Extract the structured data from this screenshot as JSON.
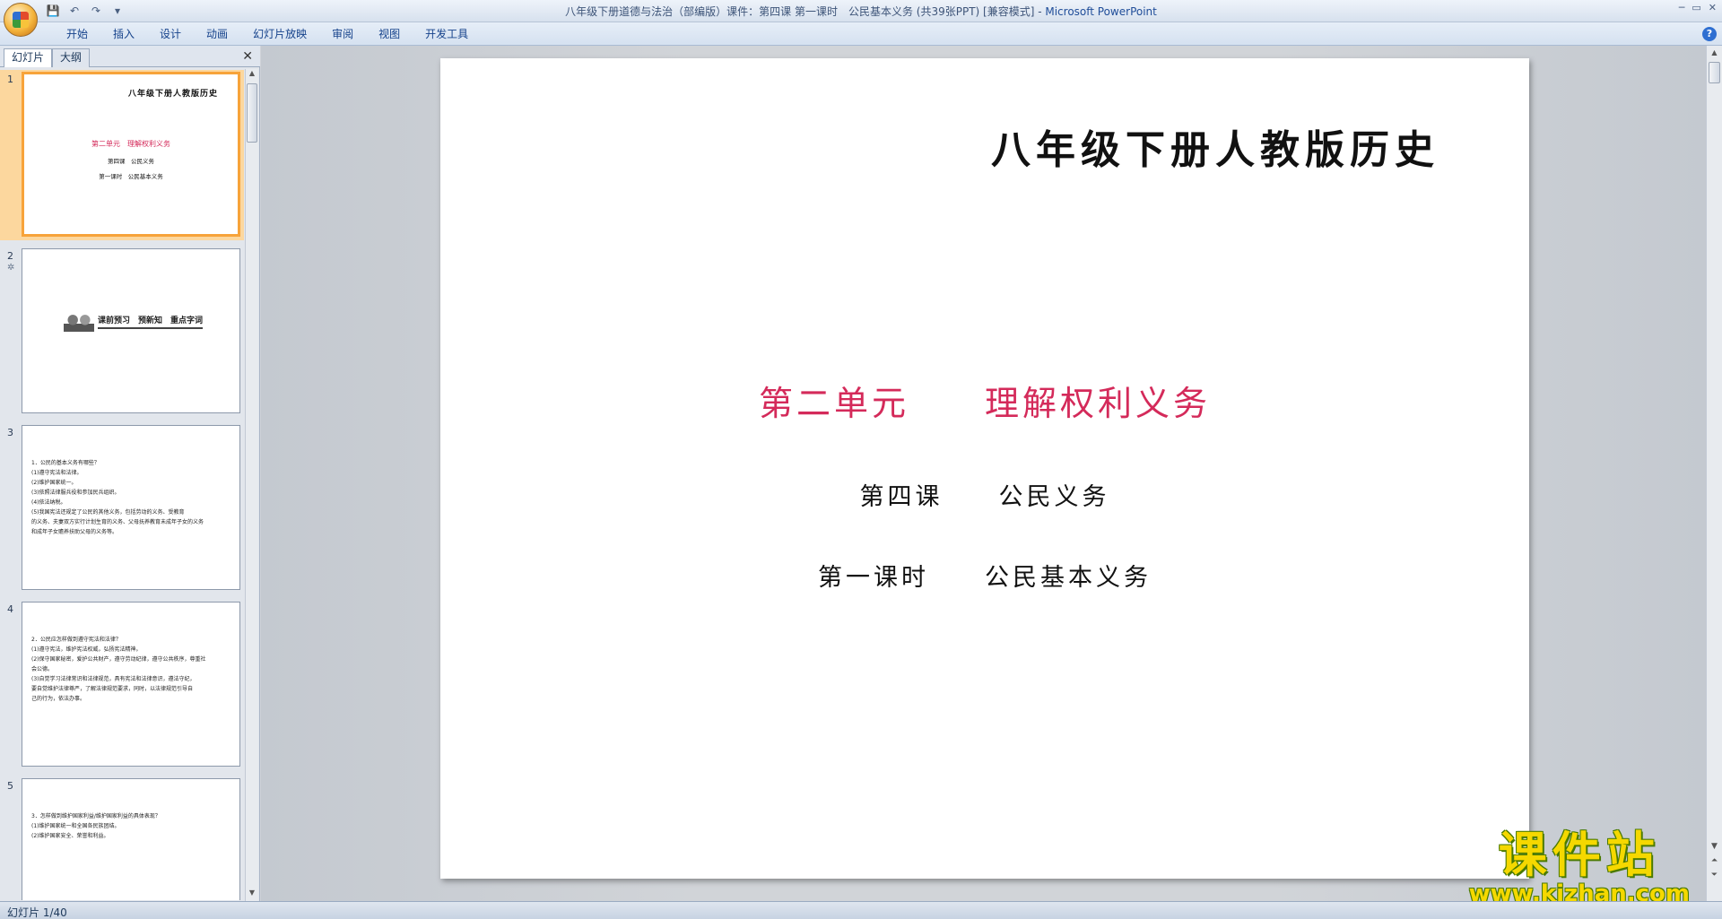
{
  "window": {
    "title": "八年级下册道德与法治（部编版）课件：第四课 第一课时　公民基本义务 (共39张PPT) [兼容模式] - ",
    "app_name": "Microsoft PowerPoint"
  },
  "ribbon": {
    "tabs": [
      "开始",
      "插入",
      "设计",
      "动画",
      "幻灯片放映",
      "审阅",
      "视图",
      "开发工具"
    ]
  },
  "left_pane": {
    "tabs": [
      "幻灯片",
      "大纲"
    ],
    "thumbnails": [
      {
        "num": "1",
        "title": "八年级下册人教版历史",
        "unit": "第二单元　理解权利义务",
        "lesson": "第四课　公民义务",
        "period": "第一课时　公民基本义务"
      },
      {
        "num": "2",
        "banner": "课前预习　预新知　重点字词"
      },
      {
        "num": "3",
        "lines": [
          "1．公民的基本义务有哪些？",
          "(1)遵守宪法和法律。",
          "(2)维护国家统一。",
          "(3)依照法律服兵役和参加民兵组织。",
          "(4)依法纳税。",
          "(5)我国宪法还规定了公民的其他义务，包括劳动的义务、受教育",
          "的义务、夫妻双方实行计划生育的义务、父母抚养教育未成年子女的义务",
          "和成年子女赡养扶助父母的义务等。"
        ]
      },
      {
        "num": "4",
        "lines": [
          "2．公民应怎样做到遵守宪法和法律？",
          "(1)遵守宪法，维护宪法权威，弘扬宪法精神。",
          "(2)保守国家秘密，爱护公共财产，遵守劳动纪律，遵守公共秩序，尊重社",
          "会公德。",
          "(3)自觉学习法律常识和法律规范，具有宪法和法律意识，遵法守纪，",
          "要自觉维护法律尊严，了解法律规范要求，同时，以法律规范引导自",
          "己的行为，依法办事。"
        ]
      },
      {
        "num": "5",
        "lines": [
          "3．怎样做到维护国家利益/维护国家利益的具体表现？",
          "(1)维护国家统一和全国各民族团结。",
          "(2)维护国家安全、荣誉和利益。"
        ]
      }
    ]
  },
  "slide": {
    "title": "八年级下册人教版历史",
    "unit": "第二单元　　理解权利义务",
    "lesson": "第四课　　公民义务",
    "period": "第一课时　　公民基本义务"
  },
  "watermark": {
    "text": "课件站",
    "url": "www.kjzhan.com"
  },
  "status": {
    "slide_counter": "幻灯片 1/40"
  }
}
